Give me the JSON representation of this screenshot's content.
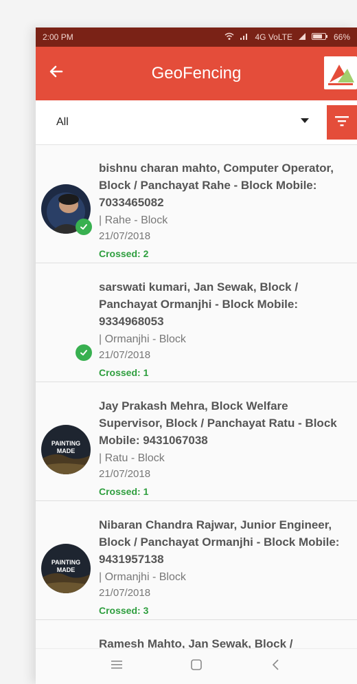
{
  "status": {
    "time": "2:00 PM",
    "network": "4G VoLTE",
    "battery": "66%"
  },
  "appbar": {
    "title": "GeoFencing"
  },
  "filter": {
    "selected": "All"
  },
  "items": [
    {
      "name": "bishnu charan mahto, Computer Operator, Block / Panchayat Rahe - Block Mobile: 7033465082",
      "location": "| Rahe - Block",
      "date": "21/07/2018",
      "crossed": "Crossed: 2",
      "avatar": "photo"
    },
    {
      "name": "sarswati kumari, Jan Sewak, Block / Panchayat Ormanjhi - Block Mobile: 9334968053",
      "location": "| Ormanjhi - Block",
      "date": "21/07/2018",
      "crossed": "Crossed: 1",
      "avatar": "none"
    },
    {
      "name": "Jay Prakash Mehra, Block Welfare Supervisor, Block / Panchayat Ratu - Block Mobile: 9431067038",
      "location": "| Ratu - Block",
      "date": "21/07/2018",
      "crossed": "Crossed: 1",
      "avatar": "placeholder",
      "avatar_text": "PAINTING MADE"
    },
    {
      "name": "Nibaran Chandra Rajwar, Junior Engineer, Block / Panchayat Ormanjhi - Block Mobile: 9431957138",
      "location": "| Ormanjhi - Block",
      "date": "21/07/2018",
      "crossed": "Crossed: 3",
      "avatar": "placeholder",
      "avatar_text": "PAINTING MADE"
    },
    {
      "name": "Ramesh Mahto, Jan Sewak, Block /",
      "location": "",
      "date": "",
      "crossed": "",
      "avatar": "none"
    }
  ],
  "colors": {
    "primary": "#e44d3a",
    "status_bar": "#7a2216",
    "crossed_text": "#2e9e3e",
    "check_badge": "#38b050"
  },
  "icons": {
    "back": "arrow-left-icon",
    "filter": "filter-icon",
    "dropdown": "caret-down-icon",
    "check": "check-circle-icon",
    "nav_menu": "menu-icon",
    "nav_home": "square-icon",
    "nav_back": "chevron-left-icon"
  }
}
